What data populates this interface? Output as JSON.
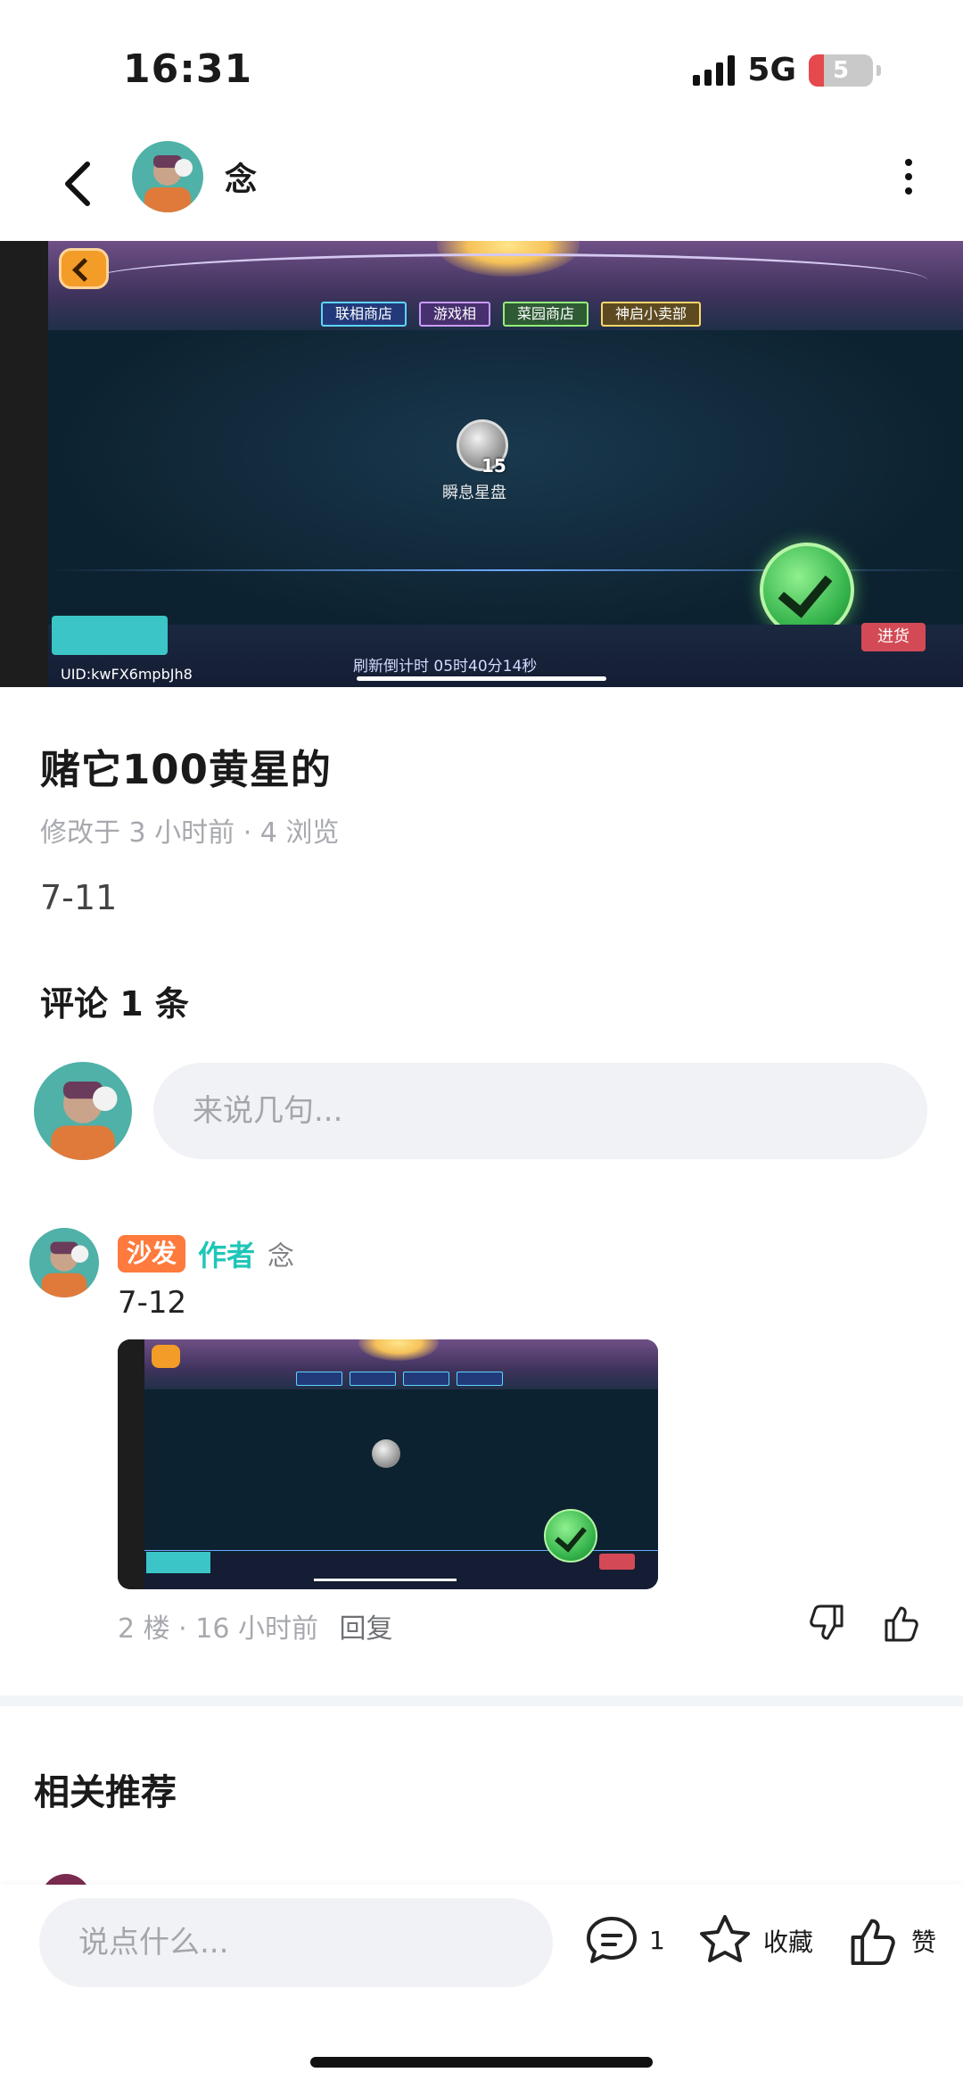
{
  "status_bar": {
    "time": "16:31",
    "network": "5G",
    "battery": "5"
  },
  "nav": {
    "username": "念",
    "back_icon": "chevron-left-icon",
    "more_icon": "vertical-dots-icon"
  },
  "post_image": {
    "tabs": [
      "联相商店",
      "游戏相",
      "菜园商店",
      "神启小卖部"
    ],
    "item_count": "15",
    "item_label": "瞬息星盘",
    "refresh_label": "刷新倒计时  05时40分14秒",
    "uid": "UID:kwFX6mpbJh8",
    "shop_button": "进货"
  },
  "post": {
    "title": "赌它100黄星的",
    "meta": "修改于 3 小时前 · 4 浏览",
    "body": "7-11"
  },
  "comments": {
    "heading": "评论 1 条",
    "input_placeholder": "来说几句...",
    "items": [
      {
        "sofa_badge": "沙发",
        "author_tag": "作者",
        "name": "念",
        "text": "7-12",
        "floor_time": "2 楼 · 16 小时前",
        "reply": "回复"
      }
    ]
  },
  "related": {
    "heading": "相关推荐"
  },
  "bottom_bar": {
    "input_placeholder": "说点什么...",
    "comment_count": "1",
    "favorite_label": "收藏",
    "like_label": "赞"
  },
  "colors": {
    "sofa": "#ff7a3d",
    "author": "#1fc6b8",
    "input_bg": "#f1f2f5",
    "muted": "#a7a9ae"
  }
}
